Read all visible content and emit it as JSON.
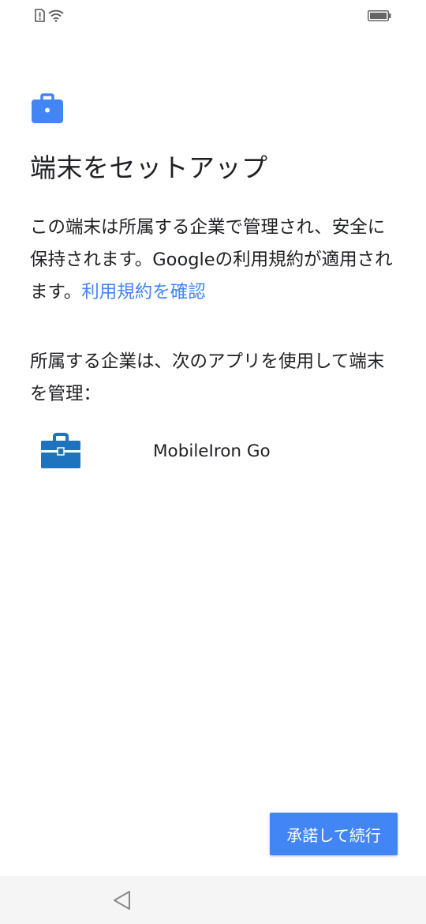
{
  "status_bar": {
    "left_icons": [
      "sim-alert-icon",
      "wifi-icon"
    ],
    "right_icons": [
      "battery-icon"
    ]
  },
  "header": {
    "icon": "briefcase-icon",
    "title": "端末をセットアップ"
  },
  "description": {
    "text": "この端末は所属する企業で管理され、安全に保持されます。Googleの利用規約が適用されます。",
    "link_text": "利用規約を確認"
  },
  "manage": {
    "label": "所属する企業は、次のアプリを使用して端末を管理："
  },
  "app": {
    "icon": "mobileiron-briefcase-icon",
    "name": "MobileIron Go"
  },
  "footer": {
    "accept_label": "承諾して続行"
  },
  "nav_bar": {
    "back_icon": "back-triangle-icon"
  },
  "colors": {
    "accent": "#4285f4",
    "app_icon": "#1e73be",
    "text": "#202124",
    "nav_bg": "#f5f5f5"
  }
}
